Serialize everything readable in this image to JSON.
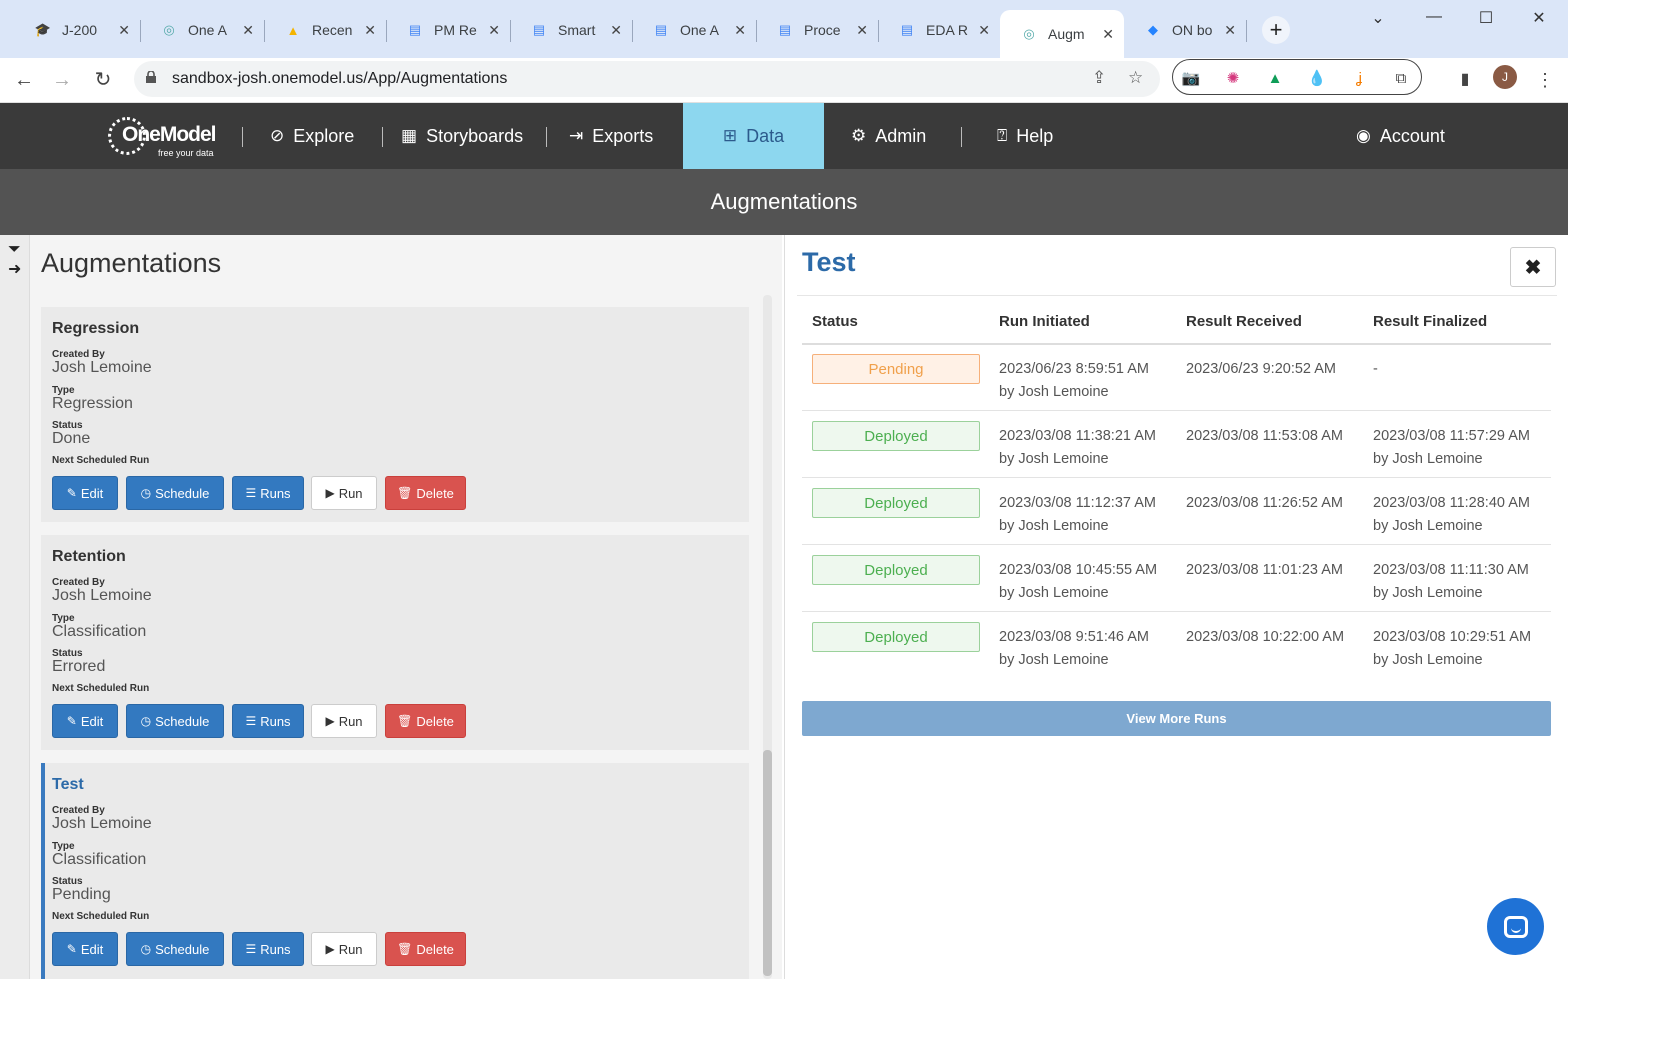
{
  "browser": {
    "tabs": [
      {
        "title": "J-200",
        "icon": "graduation-cap-icon"
      },
      {
        "title": "One A",
        "icon": "onemodel-icon"
      },
      {
        "title": "Recen",
        "icon": "google-drive-icon"
      },
      {
        "title": "PM Re",
        "icon": "google-docs-icon"
      },
      {
        "title": "Smart",
        "icon": "google-docs-icon"
      },
      {
        "title": "One A",
        "icon": "google-docs-icon"
      },
      {
        "title": "Proce",
        "icon": "google-docs-icon"
      },
      {
        "title": "EDA R",
        "icon": "google-docs-icon"
      },
      {
        "title": "Augm",
        "icon": "onemodel-icon"
      },
      {
        "title": "ON bo",
        "icon": "jira-icon"
      }
    ],
    "url": "sandbox-josh.onemodel.us/App/Augmentations",
    "profile_initial": "J"
  },
  "app": {
    "logo_name": "OneModel",
    "logo_tagline": "free your data",
    "nav": {
      "explore": "Explore",
      "storyboards": "Storyboards",
      "exports": "Exports",
      "data": "Data",
      "admin": "Admin",
      "help": "Help",
      "account": "Account"
    },
    "page_heading": "Augmentations"
  },
  "left_panel": {
    "title": "Augmentations",
    "labels": {
      "created_by": "Created By",
      "type": "Type",
      "status": "Status",
      "next_run": "Next Scheduled Run"
    },
    "buttons": {
      "edit": "Edit",
      "schedule": "Schedule",
      "runs": "Runs",
      "run": "Run",
      "delete": "Delete"
    },
    "augmentations": [
      {
        "name": "Regression",
        "created_by": "Josh Lemoine",
        "type": "Regression",
        "status": "Done"
      },
      {
        "name": "Retention",
        "created_by": "Josh Lemoine",
        "type": "Classification",
        "status": "Errored"
      },
      {
        "name": "Test",
        "created_by": "Josh Lemoine",
        "type": "Classification",
        "status": "Pending"
      }
    ]
  },
  "detail": {
    "title": "Test",
    "columns": [
      "Status",
      "Run Initiated",
      "Result Received",
      "Result Finalized"
    ],
    "runs": [
      {
        "status": "Pending",
        "initiated": "2023/06/23 8:59:51 AM",
        "initiated_by": "by Josh Lemoine",
        "received": "2023/06/23 9:20:52 AM",
        "finalized": "-",
        "finalized_by": ""
      },
      {
        "status": "Deployed",
        "initiated": "2023/03/08 11:38:21 AM",
        "initiated_by": "by Josh Lemoine",
        "received": "2023/03/08 11:53:08 AM",
        "finalized": "2023/03/08 11:57:29 AM",
        "finalized_by": "by Josh Lemoine"
      },
      {
        "status": "Deployed",
        "initiated": "2023/03/08 11:12:37 AM",
        "initiated_by": "by Josh Lemoine",
        "received": "2023/03/08 11:26:52 AM",
        "finalized": "2023/03/08 11:28:40 AM",
        "finalized_by": "by Josh Lemoine"
      },
      {
        "status": "Deployed",
        "initiated": "2023/03/08 10:45:55 AM",
        "initiated_by": "by Josh Lemoine",
        "received": "2023/03/08 11:01:23 AM",
        "finalized": "2023/03/08 11:11:30 AM",
        "finalized_by": "by Josh Lemoine"
      },
      {
        "status": "Deployed",
        "initiated": "2023/03/08 9:51:46 AM",
        "initiated_by": "by Josh Lemoine",
        "received": "2023/03/08 10:22:00 AM",
        "finalized": "2023/03/08 10:29:51 AM",
        "finalized_by": "by Josh Lemoine"
      }
    ],
    "view_more": "View More Runs"
  },
  "colors": {
    "nav_bg": "#3a3a3a",
    "nav_active": "#8dd7ef",
    "primary": "#3379c0",
    "danger": "#d9534f",
    "pending": "#f0a04b",
    "deployed": "#4caf50"
  }
}
